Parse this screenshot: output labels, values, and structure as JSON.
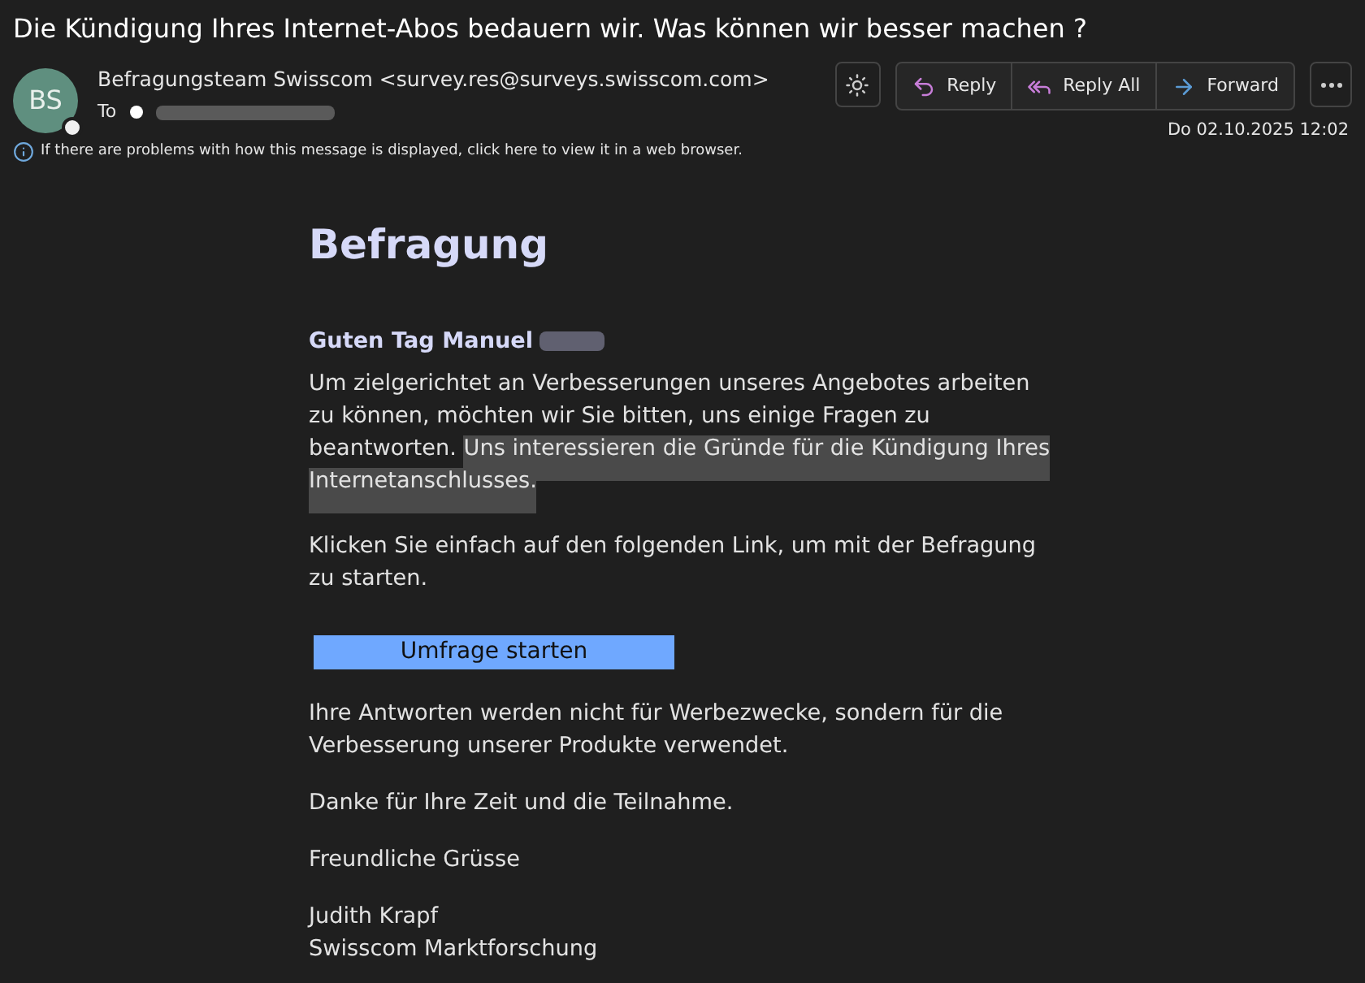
{
  "subject": "Die Kündigung Ihres Internet-Abos bedauern wir. Was können wir besser machen ?",
  "sender": {
    "initials": "BS",
    "name": "Befragungsteam Swisscom <survey.res@surveys.swisscom.com>",
    "to_label": "To"
  },
  "toolbar": [
    {
      "kind": "reply",
      "label": "Reply"
    },
    {
      "kind": "reply_all",
      "label": "Reply All"
    },
    {
      "kind": "forward",
      "label": "Forward"
    }
  ],
  "date": "Do 02.10.2025 12:02",
  "info": "If there are problems with how this message is displayed, click here to view it in a web browser.",
  "body": {
    "heading": "Befragung",
    "greeting": "Guten Tag Manuel",
    "intro": "Um zielgerichtet an Verbesserungen unseres Angebotes arbeiten zu können, möchten wir Sie bitten, uns einige Fragen zu beantworten. ",
    "intro_highlight": "Uns interessieren die Gründe für die Kündigung Ihres Internetanschlusses.",
    "click": "Klicken Sie einfach auf den folgenden Link, um mit der Befragung zu starten.",
    "button": "Umfrage starten",
    "paragraphs": [
      "Ihre Antworten werden nicht für Werbezwecke, sondern für die Verbesserung unserer Produkte verwendet.",
      "Danke für Ihre Zeit und die Teilnahme.",
      "Freundliche Grüsse"
    ],
    "signature": [
      "Judith Krapf",
      "Swisscom Marktforschung"
    ]
  }
}
